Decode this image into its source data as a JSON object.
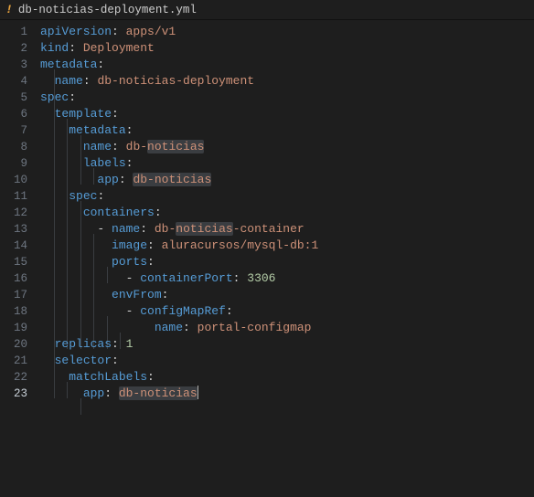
{
  "tab": {
    "icon_glyph": "!",
    "filename": "db-noticias-deployment.yml"
  },
  "gutter": {
    "count": 23,
    "active_line": 23
  },
  "code": {
    "l1": {
      "k": "apiVersion",
      "v": "apps/v1"
    },
    "l2": {
      "k": "kind",
      "v": "Deployment"
    },
    "l3": {
      "k": "metadata"
    },
    "l4": {
      "k": "name",
      "v": "db-noticias-deployment"
    },
    "l5": {
      "k": "spec"
    },
    "l6": {
      "k": "template"
    },
    "l7": {
      "k": "metadata"
    },
    "l8": {
      "k": "name",
      "v": "db-noticias"
    },
    "l9": {
      "k": "labels"
    },
    "l10": {
      "k": "app",
      "v": "db-noticias"
    },
    "l11": {
      "k": "spec"
    },
    "l12": {
      "k": "containers"
    },
    "l13": {
      "dash": "- ",
      "k": "name",
      "v": "db-noticias-container"
    },
    "l14": {
      "k": "image",
      "v": "aluracursos/mysql-db:1"
    },
    "l15": {
      "k": "ports"
    },
    "l16": {
      "dash": "- ",
      "k": "containerPort",
      "n": "3306"
    },
    "l17": {
      "k": "envFrom"
    },
    "l18": {
      "dash": "- ",
      "k": "configMapRef"
    },
    "l19": {
      "k": "name",
      "v": "portal-configmap"
    },
    "l20": {
      "k": "replicas",
      "n": "1"
    },
    "l21": {
      "k": "selector"
    },
    "l22": {
      "k": "matchLabels"
    },
    "l23": {
      "k": "app",
      "v": "db-noticias"
    }
  },
  "colors": {
    "bg": "#1e1e1e",
    "key": "#569cd6",
    "string": "#ce9178",
    "number": "#b5cea8",
    "gutter": "#6e7681",
    "highlight": "#3a3d41"
  }
}
